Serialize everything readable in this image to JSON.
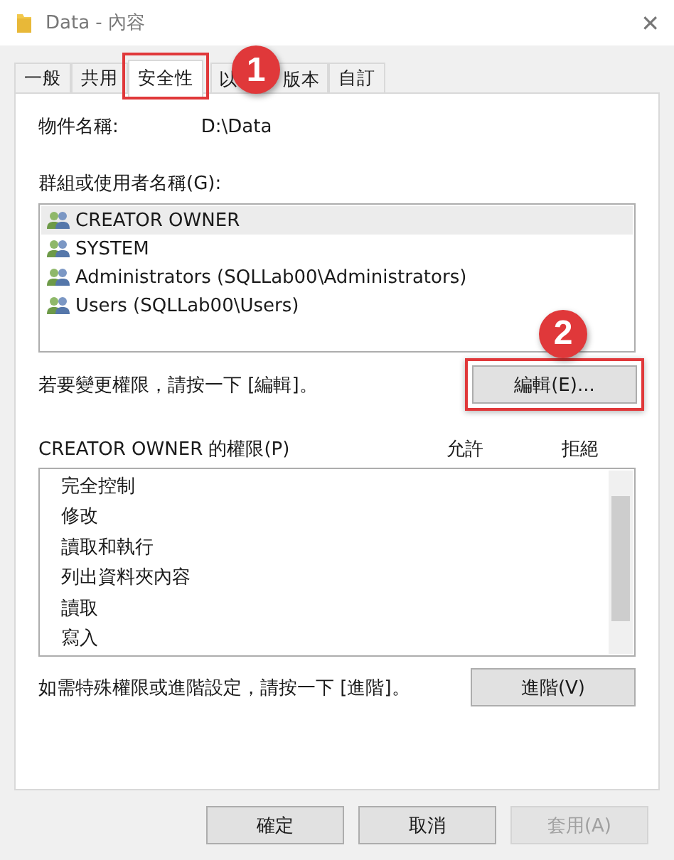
{
  "window": {
    "title": "Data - 內容",
    "close": "✕"
  },
  "tabs": [
    {
      "label": "一般",
      "selected": false
    },
    {
      "label": "共用",
      "selected": false
    },
    {
      "label": "安全性",
      "selected": true,
      "highlighted": true
    },
    {
      "label_parts": [
        "以",
        "版本"
      ],
      "selected": false
    },
    {
      "label": "自訂",
      "selected": false
    }
  ],
  "object_name": {
    "label": "物件名稱:",
    "value": "D:\\Data"
  },
  "groups": {
    "label": "群組或使用者名稱(G):",
    "items": [
      {
        "name": "CREATOR OWNER",
        "selected": true
      },
      {
        "name": "SYSTEM",
        "selected": false
      },
      {
        "name": "Administrators (SQLLab00\\Administrators)",
        "selected": false
      },
      {
        "name": "Users (SQLLab00\\Users)",
        "selected": false
      }
    ]
  },
  "edit_hint": "若要變更權限，請按一下 [編輯]。",
  "edit_button": "編輯(E)...",
  "permissions": {
    "label": "CREATOR OWNER 的權限(P)",
    "allow": "允許",
    "deny": "拒絕",
    "items": [
      "完全控制",
      "修改",
      "讀取和執行",
      "列出資料夾內容",
      "讀取",
      "寫入"
    ]
  },
  "advanced_hint": "如需特殊權限或進階設定，請按一下 [進階]。",
  "advanced_button": "進階(V)",
  "buttons": [
    {
      "label": "確定",
      "disabled": false
    },
    {
      "label": "取消",
      "disabled": false
    },
    {
      "label": "套用(A)",
      "disabled": true
    }
  ],
  "callouts": [
    "1",
    "2"
  ]
}
